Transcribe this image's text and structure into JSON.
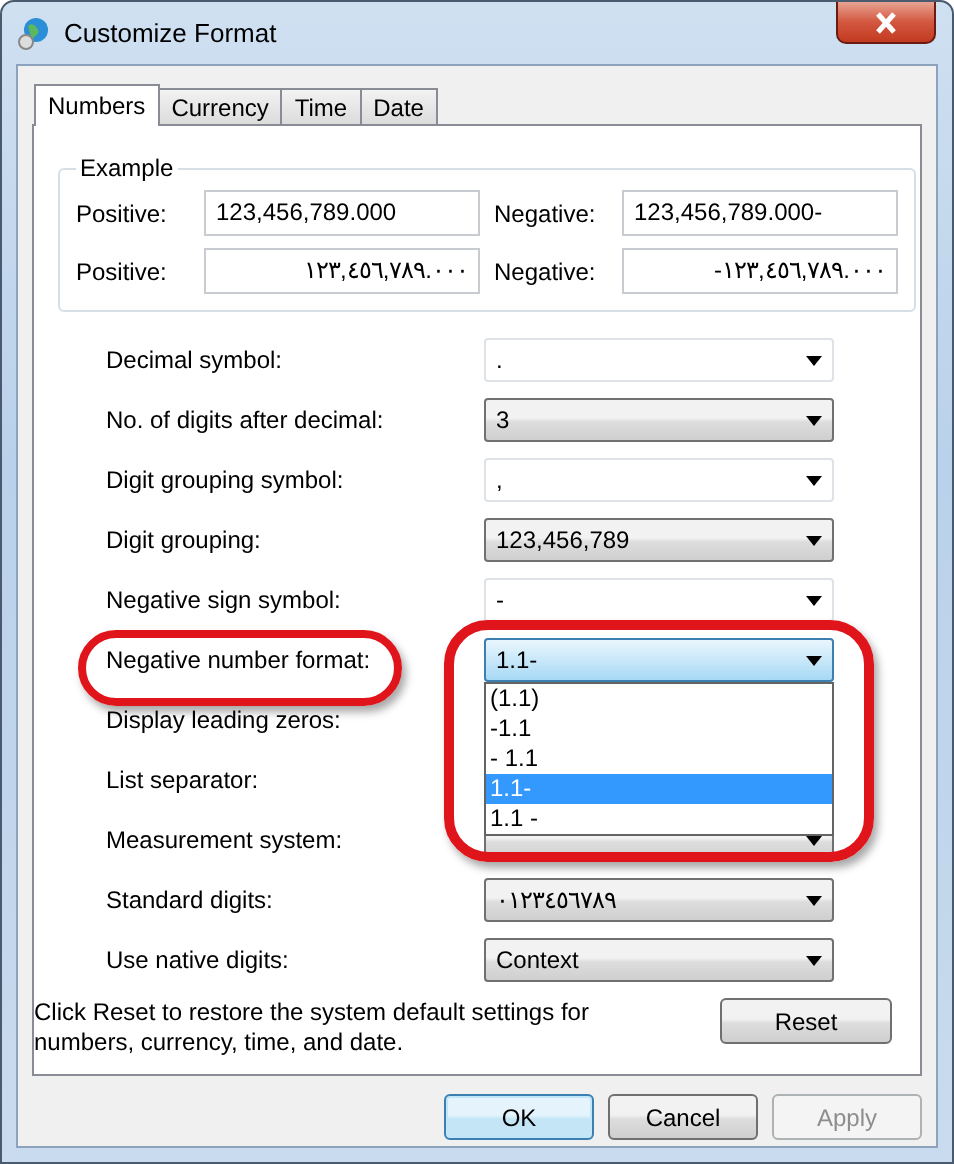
{
  "window": {
    "title": "Customize Format"
  },
  "tabs": [
    {
      "label": "Numbers",
      "selected": true
    },
    {
      "label": "Currency",
      "selected": false
    },
    {
      "label": "Time",
      "selected": false
    },
    {
      "label": "Date",
      "selected": false
    }
  ],
  "example": {
    "title": "Example",
    "rows": [
      {
        "positive_label": "Positive:",
        "positive": "123,456,789.000",
        "negative_label": "Negative:",
        "negative": "123,456,789.000-",
        "kind": "latin"
      },
      {
        "positive_label": "Positive:",
        "positive": "١٢٣,٤٥٦,٧٨٩.٠٠٠",
        "negative_label": "Negative:",
        "negative": "-١٢٣,٤٥٦,٧٨٩.٠٠٠",
        "kind": "native"
      }
    ]
  },
  "settings": [
    {
      "label": "Decimal symbol:",
      "value": ".",
      "kind": "editable",
      "highlighted": false
    },
    {
      "label": "No. of digits after decimal:",
      "value": "3",
      "kind": "dropdown",
      "highlighted": false
    },
    {
      "label": "Digit grouping symbol:",
      "value": ",",
      "kind": "editable",
      "highlighted": false
    },
    {
      "label": "Digit grouping:",
      "value": "123,456,789",
      "kind": "dropdown",
      "highlighted": false
    },
    {
      "label": "Negative sign symbol:",
      "value": "-",
      "kind": "editable",
      "highlighted": false
    },
    {
      "label": "Negative number format:",
      "value": "1.1-",
      "kind": "dropdown",
      "highlighted": true,
      "options": [
        {
          "label": "(1.1)",
          "selected": false
        },
        {
          "label": "-1.1",
          "selected": false
        },
        {
          "label": "- 1.1",
          "selected": false
        },
        {
          "label": "1.1-",
          "selected": true
        },
        {
          "label": "1.1 -",
          "selected": false
        }
      ]
    },
    {
      "label": "Display leading zeros:",
      "kind": "hidden",
      "highlighted": false
    },
    {
      "label": "List separator:",
      "kind": "hidden",
      "highlighted": false
    },
    {
      "label": "Measurement system:",
      "kind": "dropdown",
      "highlighted": false
    },
    {
      "label": "Standard digits:",
      "value": "٠١٢٣٤٥٦٧٨٩",
      "kind": "dropdown",
      "highlighted": false
    },
    {
      "label": "Use native digits:",
      "value": "Context",
      "kind": "dropdown",
      "highlighted": false
    }
  ],
  "reset_note": "Click Reset to restore the system default settings for numbers, currency, time, and date.",
  "reset_button": "Reset",
  "buttons": [
    {
      "label": "OK",
      "kind": "default",
      "disabled": false
    },
    {
      "label": "Cancel",
      "kind": "normal",
      "disabled": false
    },
    {
      "label": "Apply",
      "kind": "normal",
      "disabled": true
    }
  ]
}
